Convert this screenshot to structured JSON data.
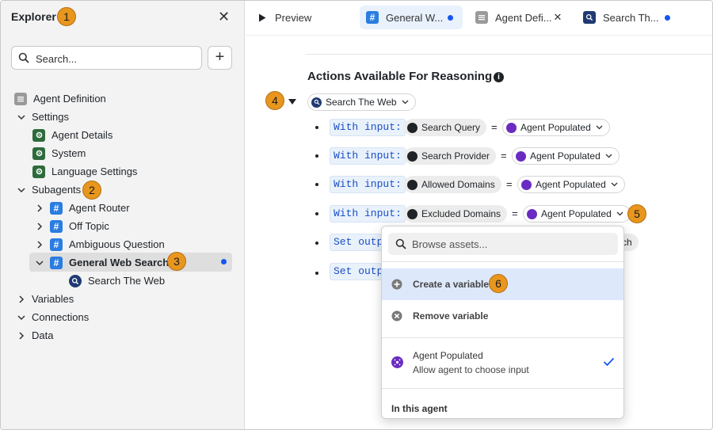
{
  "sidebar": {
    "title": "Explorer",
    "close_glyph": "✕",
    "search_placeholder": "Search...",
    "add_glyph": "+",
    "tree": {
      "agent_definition": "Agent Definition",
      "settings": "Settings",
      "agent_details": "Agent Details",
      "system": "System",
      "language_settings": "Language Settings",
      "subagents": "Subagents",
      "agent_router": "Agent Router",
      "off_topic": "Off Topic",
      "ambiguous_question": "Ambiguous Question",
      "general_web_search": "General Web Search",
      "search_the_web": "Search The Web",
      "variables": "Variables",
      "connections": "Connections",
      "data": "Data"
    }
  },
  "tabs": {
    "preview": "Preview",
    "general_web": "General W...",
    "agent_def": "Agent Defi...",
    "search_the": "Search Th...",
    "close_glyph": "✕"
  },
  "main": {
    "section_title": "Actions Available For Reasoning",
    "info_glyph": "i",
    "action_name": "Search The Web",
    "with_input": "With input:",
    "set_output": "Set output",
    "equals": "=",
    "rows": [
      {
        "param": "Search Query",
        "value": "Agent Populated"
      },
      {
        "param": "Search Provider",
        "value": "Agent Populated"
      },
      {
        "param": "Allowed Domains",
        "value": "Agent Populated"
      },
      {
        "param": "Excluded Domains",
        "value": "Agent Populated"
      }
    ],
    "partial_pill": "ch"
  },
  "dropdown": {
    "search_placeholder": "Browse assets...",
    "create_variable": "Create a variable",
    "remove_variable": "Remove variable",
    "agent_populated_title": "Agent Populated",
    "agent_populated_desc": "Allow agent to choose input",
    "section_in_agent": "In this agent"
  },
  "callouts": [
    "1",
    "2",
    "3",
    "4",
    "5",
    "6"
  ],
  "colors": {
    "accent_blue": "#1456f0",
    "badge_orange": "#e8961e",
    "code_blue": "#1a4ec6",
    "highlight": "#dde8fb"
  }
}
